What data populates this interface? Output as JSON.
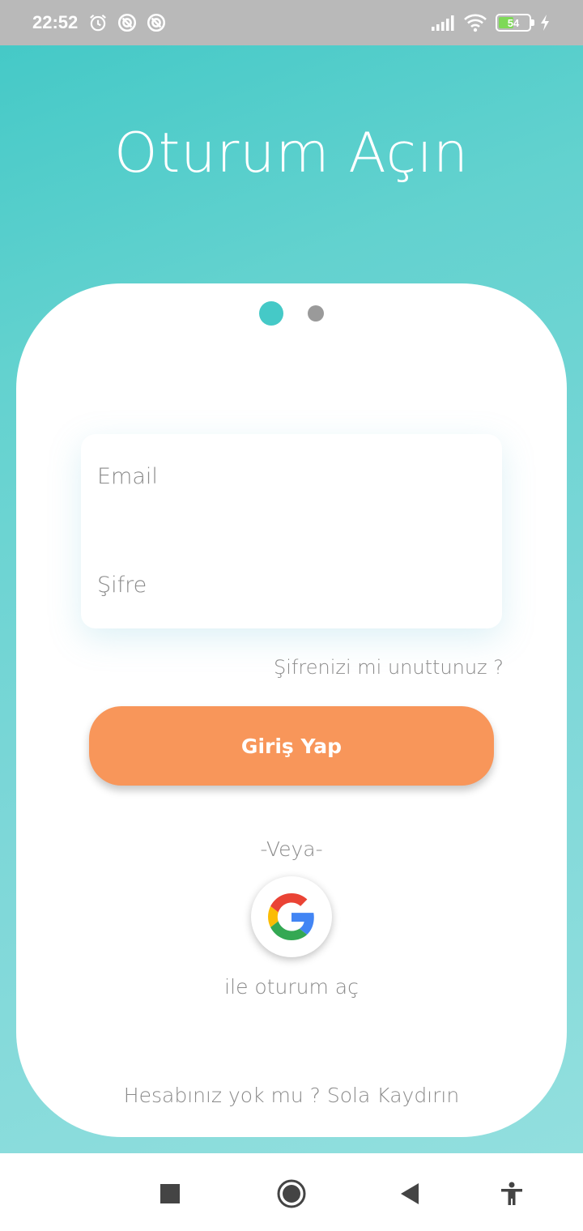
{
  "status_bar": {
    "time": "22:52",
    "battery_level": "54",
    "battery_fraction": 0.54,
    "icons": [
      "alarm-icon",
      "sync-icon",
      "sync-icon",
      "signal-icon",
      "wifi-icon",
      "battery-icon",
      "charging-icon"
    ]
  },
  "colors": {
    "accent": "#45c9c7",
    "button": "#f8965a",
    "text_muted": "#8a8a8a"
  },
  "header": {
    "title": "Oturum Açın"
  },
  "pager": {
    "active_index": 0,
    "count": 2
  },
  "form": {
    "email_placeholder": "Email",
    "password_placeholder": "Şifre",
    "forgot_password": "Şifrenizi mi unuttunuz ?",
    "login_button": "Giriş Yap"
  },
  "alt_login": {
    "or_text": "-Veya-",
    "google_icon": "google-icon",
    "google_label": "ile oturum aç"
  },
  "footer": {
    "signup_hint": "Hesabınız yok mu ? Sola Kaydırın"
  },
  "nav_bar": {
    "icons": [
      "square-icon",
      "home-circle-icon",
      "back-triangle-icon",
      "accessibility-icon"
    ]
  }
}
